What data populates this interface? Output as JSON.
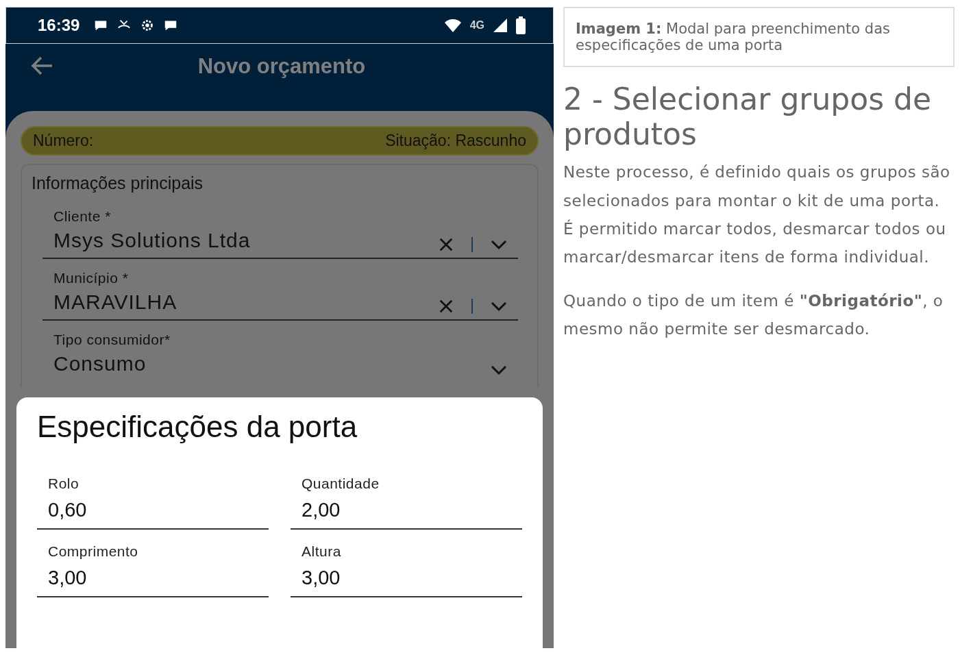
{
  "phone": {
    "status_bar": {
      "time": "16:39",
      "network": "4G"
    },
    "app_bar": {
      "title": "Novo orçamento"
    },
    "banner": {
      "number_label": "Número:",
      "status": "Situação: Rascunho"
    },
    "section_title": "Informações principais",
    "fields": [
      {
        "label": "Cliente *",
        "value": "Msys Solutions Ltda",
        "kind": "clearable"
      },
      {
        "label": "Município *",
        "value": "MARAVILHA",
        "kind": "clearable"
      },
      {
        "label": "Tipo consumidor*",
        "value": "Consumo",
        "kind": "dropdown"
      }
    ],
    "modal": {
      "title": "Especificações da porta",
      "fields": [
        {
          "label": "Rolo",
          "value": "0,60"
        },
        {
          "label": "Quantidade",
          "value": "2,00"
        },
        {
          "label": "Comprimento",
          "value": "3,00"
        },
        {
          "label": "Altura",
          "value": "3,00"
        }
      ]
    }
  },
  "document": {
    "caption": "**Imagem 1:** Modal para preenchimento das especificações de uma porta",
    "heading": "2 - Selecionar grupos de produtos",
    "paragraphs": [
      "Neste processo, é definido quais os grupos são selecionados para montar o kit de uma porta. É permitido marcar todos, desmarcar todos ou marcar/desmarcar itens de forma individual.",
      "Quando o tipo de um item é **\"Obrigatório\"**, o mesmo não permite ser desmarcado."
    ]
  }
}
